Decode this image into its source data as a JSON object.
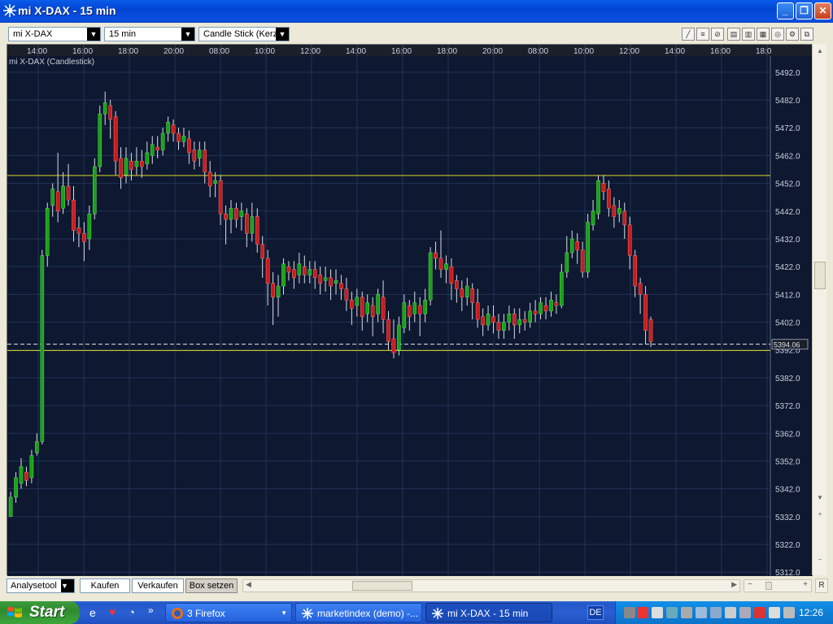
{
  "window": {
    "title": "mi X-DAX - 15 min",
    "minimize_label": "_",
    "restore_label": "❐",
    "close_label": "✕"
  },
  "toolbar": {
    "symbol_value": "mi X-DAX",
    "interval_value": "15 min",
    "charttype_value": "Candle Stick (Kerze"
  },
  "bottombar": {
    "analysetool_label": "Analysetool",
    "buy_label": "Kaufen",
    "sell_label": "Verkaufen",
    "box_label": "Box setzen",
    "r_label": "R"
  },
  "taskbar": {
    "start_label": "Start",
    "tasks": [
      {
        "label": "3 Firefox"
      },
      {
        "label": "marketindex (demo) -..."
      },
      {
        "label": "mi X-DAX - 15 min"
      }
    ],
    "lang": "DE",
    "clock": "12:26"
  },
  "colors": {
    "chart_bg": "#0e1830",
    "grid": "#1f3358",
    "up_candle": "#17a316",
    "down_candle": "#cc1b1b",
    "hline": "#dcd82a"
  },
  "chart_data": {
    "type": "candlestick",
    "title": "mi X-DAX (Candlestick)",
    "x_tick_labels": [
      "14:00",
      "16:00",
      "18:00",
      "20:00",
      "08:00",
      "10:00",
      "12:00",
      "14:00",
      "16:00",
      "18:00",
      "20:00",
      "08:00",
      "10:00",
      "12:00",
      "14:00",
      "16:00",
      "18:0"
    ],
    "y_tick_labels": [
      "5492.0",
      "5482.0",
      "5472.0",
      "5462.0",
      "5452.0",
      "5442.0",
      "5432.0",
      "5422.0",
      "5412.0",
      "5402.0",
      "5392.0",
      "5382.0",
      "5372.0",
      "5362.0",
      "5352.0",
      "5342.0",
      "5332.0",
      "5322.0",
      "5312.0"
    ],
    "ylim": [
      5310.6,
      5497.8
    ],
    "current_price": "5394.06",
    "horizontal_lines": [
      5454.8,
      5391.8
    ],
    "grid": true,
    "candles": [
      [
        5332,
        5339,
        5333,
        5341
      ],
      [
        5339,
        5346,
        5337,
        5348
      ],
      [
        5344,
        5350,
        5342,
        5353
      ],
      [
        5348,
        5345,
        5343,
        5350
      ],
      [
        5346,
        5354,
        5344,
        5356
      ],
      [
        5355,
        5359,
        5354,
        5362
      ],
      [
        5359,
        5426,
        5358,
        5428
      ],
      [
        5426,
        5443,
        5422,
        5445
      ],
      [
        5444,
        5450,
        5440,
        5452
      ],
      [
        5449,
        5442,
        5438,
        5463
      ],
      [
        5443,
        5451,
        5441,
        5456
      ],
      [
        5451,
        5446,
        5444,
        5459
      ],
      [
        5446,
        5435,
        5431,
        5451
      ],
      [
        5436,
        5434,
        5429,
        5440
      ],
      [
        5434,
        5431,
        5424,
        5438
      ],
      [
        5432,
        5441,
        5428,
        5444
      ],
      [
        5441,
        5458,
        5439,
        5461
      ],
      [
        5458,
        5477,
        5456,
        5480
      ],
      [
        5477,
        5481,
        5473,
        5485
      ],
      [
        5480,
        5475,
        5468,
        5482
      ],
      [
        5476,
        5460,
        5455,
        5478
      ],
      [
        5461,
        5454,
        5450,
        5465
      ],
      [
        5455,
        5461,
        5452,
        5465
      ],
      [
        5460,
        5457,
        5453,
        5463
      ],
      [
        5458,
        5460,
        5455,
        5465
      ],
      [
        5460,
        5458,
        5454,
        5464
      ],
      [
        5459,
        5463,
        5457,
        5467
      ],
      [
        5462,
        5466,
        5459,
        5469
      ],
      [
        5465,
        5464,
        5461,
        5469
      ],
      [
        5464,
        5470,
        5462,
        5472
      ],
      [
        5470,
        5474,
        5467,
        5476
      ],
      [
        5473,
        5470,
        5467,
        5475
      ],
      [
        5470,
        5467,
        5464,
        5472
      ],
      [
        5467,
        5469,
        5465,
        5472
      ],
      [
        5468,
        5463,
        5459,
        5471
      ],
      [
        5464,
        5460,
        5457,
        5467
      ],
      [
        5461,
        5464,
        5458,
        5467
      ],
      [
        5464,
        5456,
        5452,
        5467
      ],
      [
        5456,
        5451,
        5447,
        5460
      ],
      [
        5452,
        5453,
        5447,
        5456
      ],
      [
        5453,
        5441,
        5437,
        5455
      ],
      [
        5441,
        5439,
        5430,
        5444
      ],
      [
        5439,
        5443,
        5434,
        5446
      ],
      [
        5443,
        5439,
        5436,
        5445
      ],
      [
        5440,
        5442,
        5435,
        5445
      ],
      [
        5441,
        5434,
        5429,
        5443
      ],
      [
        5434,
        5440,
        5431,
        5445
      ],
      [
        5440,
        5430,
        5427,
        5443
      ],
      [
        5430,
        5425,
        5418,
        5433
      ],
      [
        5425,
        5416,
        5408,
        5428
      ],
      [
        5416,
        5411,
        5401,
        5420
      ],
      [
        5411,
        5415,
        5404,
        5419
      ],
      [
        5415,
        5423,
        5412,
        5425
      ],
      [
        5422,
        5420,
        5417,
        5424
      ],
      [
        5421,
        5418,
        5414,
        5424
      ],
      [
        5419,
        5423,
        5416,
        5427
      ],
      [
        5422,
        5419,
        5416,
        5426
      ],
      [
        5419,
        5421,
        5416,
        5424
      ],
      [
        5421,
        5418,
        5414,
        5424
      ],
      [
        5419,
        5416,
        5412,
        5422
      ],
      [
        5417,
        5418,
        5413,
        5422
      ],
      [
        5418,
        5415,
        5410,
        5421
      ],
      [
        5416,
        5417,
        5412,
        5421
      ],
      [
        5416,
        5414,
        5410,
        5419
      ],
      [
        5414,
        5410,
        5406,
        5418
      ],
      [
        5410,
        5407,
        5401,
        5413
      ],
      [
        5408,
        5411,
        5404,
        5414
      ],
      [
        5411,
        5404,
        5399,
        5413
      ],
      [
        5405,
        5409,
        5402,
        5412
      ],
      [
        5408,
        5404,
        5397,
        5411
      ],
      [
        5405,
        5412,
        5402,
        5414
      ],
      [
        5411,
        5403,
        5398,
        5417
      ],
      [
        5403,
        5395,
        5392,
        5406
      ],
      [
        5396,
        5391,
        5389,
        5403
      ],
      [
        5392,
        5401,
        5390,
        5404
      ],
      [
        5400,
        5409,
        5398,
        5412
      ],
      [
        5408,
        5404,
        5399,
        5410
      ],
      [
        5405,
        5409,
        5402,
        5413
      ],
      [
        5408,
        5405,
        5397,
        5411
      ],
      [
        5405,
        5410,
        5402,
        5414
      ],
      [
        5410,
        5427,
        5408,
        5429
      ],
      [
        5427,
        5425,
        5421,
        5431
      ],
      [
        5425,
        5421,
        5418,
        5435
      ],
      [
        5421,
        5423,
        5416,
        5426
      ],
      [
        5422,
        5416,
        5410,
        5425
      ],
      [
        5417,
        5414,
        5409,
        5419
      ],
      [
        5414,
        5411,
        5406,
        5417
      ],
      [
        5411,
        5415,
        5408,
        5418
      ],
      [
        5414,
        5409,
        5403,
        5416
      ],
      [
        5409,
        5403,
        5400,
        5414
      ],
      [
        5404,
        5401,
        5397,
        5407
      ],
      [
        5401,
        5405,
        5399,
        5408
      ],
      [
        5404,
        5402,
        5398,
        5408
      ],
      [
        5402,
        5399,
        5396,
        5405
      ],
      [
        5399,
        5402,
        5396,
        5405
      ],
      [
        5402,
        5405,
        5399,
        5408
      ],
      [
        5405,
        5401,
        5396,
        5407
      ],
      [
        5401,
        5403,
        5398,
        5407
      ],
      [
        5403,
        5402,
        5399,
        5406
      ],
      [
        5402,
        5406,
        5400,
        5409
      ],
      [
        5406,
        5405,
        5402,
        5410
      ],
      [
        5405,
        5409,
        5403,
        5411
      ],
      [
        5408,
        5406,
        5403,
        5411
      ],
      [
        5406,
        5410,
        5404,
        5413
      ],
      [
        5409,
        5408,
        5405,
        5412
      ],
      [
        5408,
        5420,
        5407,
        5423
      ],
      [
        5420,
        5427,
        5418,
        5433
      ],
      [
        5427,
        5432,
        5425,
        5435
      ],
      [
        5431,
        5428,
        5423,
        5434
      ],
      [
        5428,
        5420,
        5418,
        5431
      ],
      [
        5420,
        5438,
        5418,
        5441
      ],
      [
        5437,
        5442,
        5435,
        5446
      ],
      [
        5441,
        5453,
        5439,
        5455
      ],
      [
        5452,
        5449,
        5446,
        5455
      ],
      [
        5450,
        5443,
        5440,
        5453
      ],
      [
        5444,
        5440,
        5436,
        5447
      ],
      [
        5441,
        5443,
        5438,
        5446
      ],
      [
        5442,
        5437,
        5432,
        5445
      ],
      [
        5437,
        5426,
        5421,
        5440
      ],
      [
        5426,
        5415,
        5411,
        5428
      ],
      [
        5416,
        5412,
        5405,
        5418
      ],
      [
        5412,
        5399,
        5394,
        5415
      ],
      [
        5403,
        5395,
        5393,
        5404
      ]
    ]
  }
}
